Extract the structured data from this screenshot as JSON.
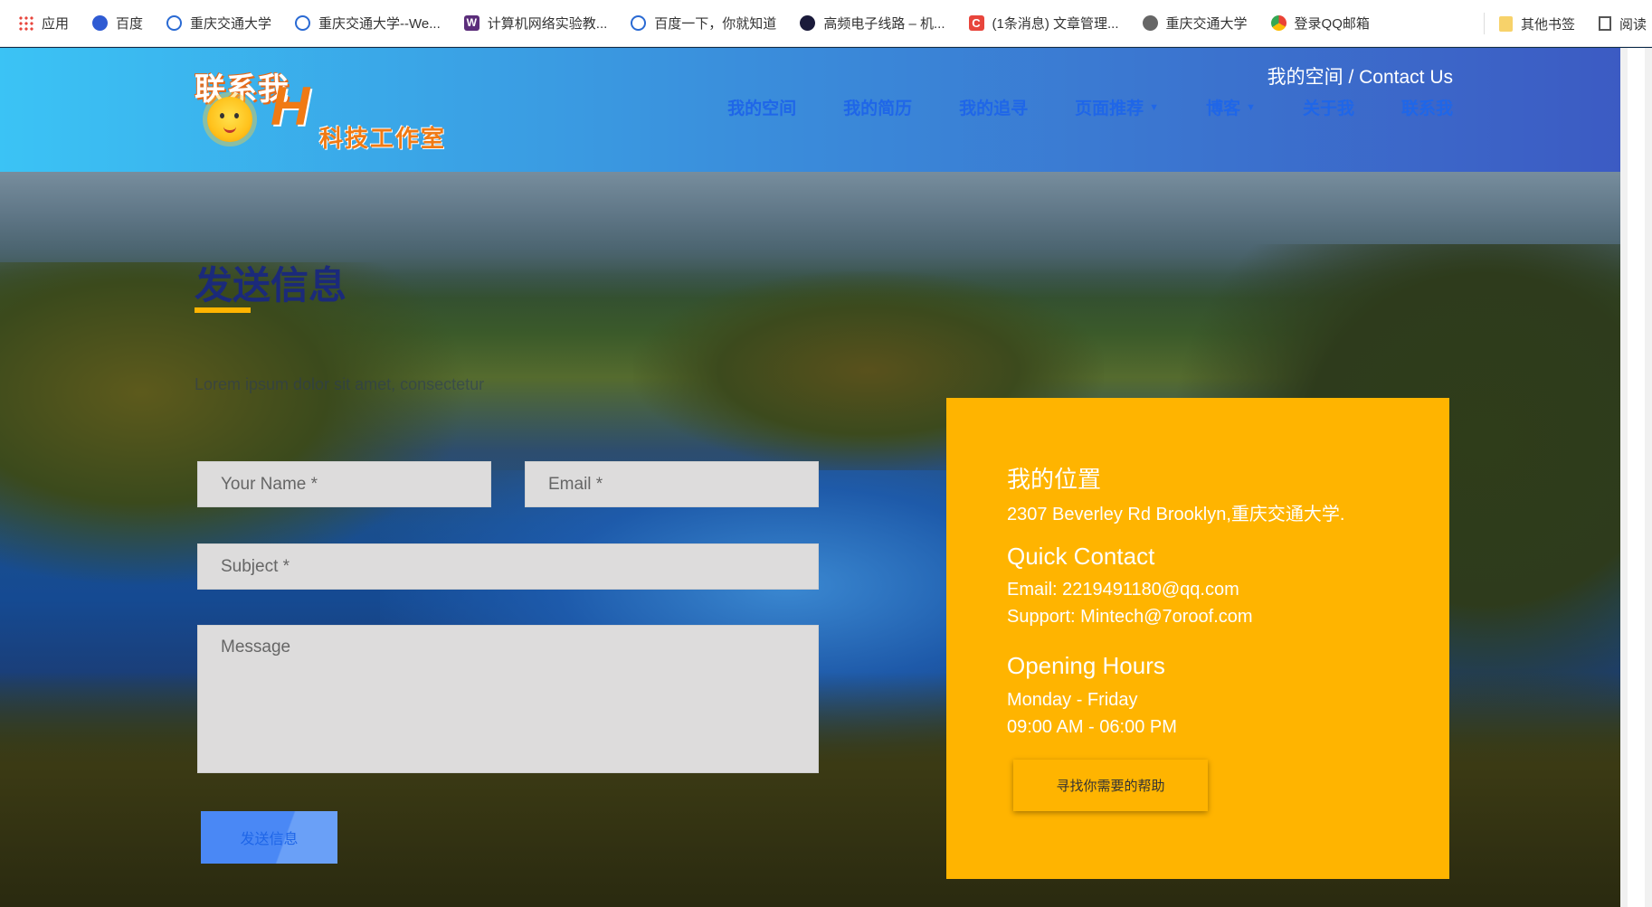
{
  "bookmarks": [
    {
      "label": "应用",
      "icon": "apps-grid-icon"
    },
    {
      "label": "百度",
      "icon": "baidu-paw-icon"
    },
    {
      "label": "重庆交通大学",
      "icon": "university-icon"
    },
    {
      "label": "重庆交通大学--We...",
      "icon": "university-icon"
    },
    {
      "label": "计算机网络实验教...",
      "icon": "w-icon"
    },
    {
      "label": "百度一下，你就知道",
      "icon": "university-icon"
    },
    {
      "label": "高频电子线路 – 机...",
      "icon": "dark-circle-icon"
    },
    {
      "label": "(1条消息) 文章管理...",
      "icon": "csdn-icon"
    },
    {
      "label": "重庆交通大学",
      "icon": "globe-icon"
    },
    {
      "label": "登录QQ邮箱",
      "icon": "qq-mail-icon"
    }
  ],
  "bookmarks_right": {
    "other": "其他书签",
    "reader": "阅读"
  },
  "logo": {
    "line1": "联系我",
    "letter": "H",
    "line2": "科技工作室"
  },
  "breadcrumb": "我的空间 / Contact Us",
  "nav": [
    {
      "label": "我的空间",
      "dropdown": false
    },
    {
      "label": "我的简历",
      "dropdown": false
    },
    {
      "label": "我的追寻",
      "dropdown": false
    },
    {
      "label": "页面推荐",
      "dropdown": true
    },
    {
      "label": "博客",
      "dropdown": true
    },
    {
      "label": "关于我",
      "dropdown": false
    },
    {
      "label": "联系我",
      "dropdown": false
    }
  ],
  "form": {
    "title": "发送信息",
    "subtitle": "Lorem ipsum dolor sit amet, consectetur",
    "name_placeholder": "Your Name *",
    "email_placeholder": "Email *",
    "subject_placeholder": "Subject *",
    "message_placeholder": "Message",
    "submit_label": "发送信息"
  },
  "contact": {
    "location_title": "我的位置",
    "address": "2307 Beverley Rd Brooklyn,重庆交通大学.",
    "quick_title": "Quick Contact",
    "email": "Email: 2219491180@qq.com",
    "support": "Support: Mintech@7oroof.com",
    "hours_title": "Opening Hours",
    "days": "Monday - Friday",
    "time": "09:00 AM - 06:00 PM",
    "help_label": "寻找你需要的帮助"
  },
  "colors": {
    "accent": "#ffb400",
    "nav_link": "#1f66e8",
    "title": "#1b2a7a",
    "button": "#4a88f5"
  }
}
